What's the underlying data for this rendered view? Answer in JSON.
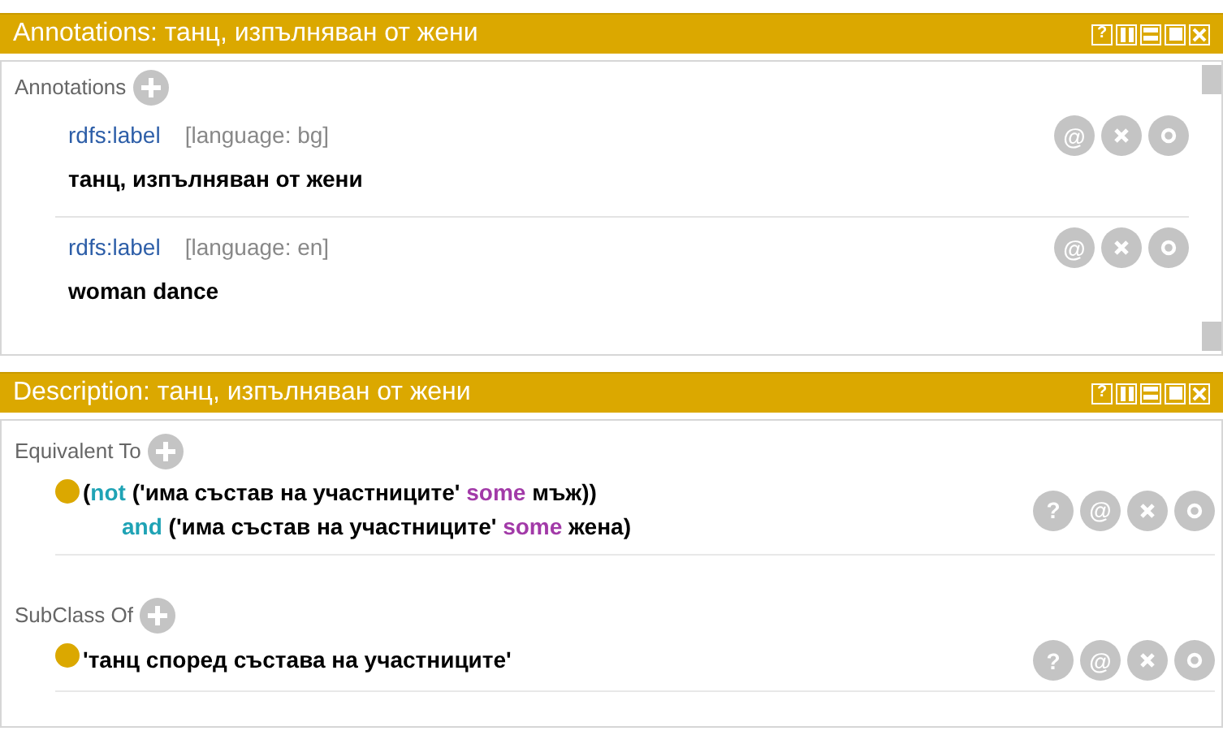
{
  "panels": [
    {
      "kind": "annotations",
      "title": "Annotations: танц, изпълняван от жени",
      "header_buttons": [
        {
          "kind": "help",
          "glyph": "?"
        },
        {
          "kind": "split-v"
        },
        {
          "kind": "split-h"
        },
        {
          "kind": "maximize"
        },
        {
          "kind": "close"
        }
      ],
      "sections": [
        {
          "label": "Annotations",
          "items": [
            {
              "property": "rdfs:label",
              "language": "[language: bg]",
              "value": "танц, изпълняван от жени",
              "actions": [
                {
                  "kind": "annotate",
                  "glyph": "@"
                },
                {
                  "kind": "delete"
                },
                {
                  "kind": "edit"
                }
              ]
            },
            {
              "property": "rdfs:label",
              "language": "[language: en]",
              "value": "woman dance",
              "actions": [
                {
                  "kind": "annotate",
                  "glyph": "@"
                },
                {
                  "kind": "delete"
                },
                {
                  "kind": "edit"
                }
              ]
            }
          ]
        }
      ]
    },
    {
      "kind": "description",
      "title": "Description: танц, изпълняван от жени",
      "header_buttons": [
        {
          "kind": "help",
          "glyph": "?"
        },
        {
          "kind": "split-v"
        },
        {
          "kind": "split-h"
        },
        {
          "kind": "maximize"
        },
        {
          "kind": "close"
        }
      ],
      "sections": [
        {
          "label": "Equivalent To",
          "items": [
            {
              "lines": [
                [
                  {
                    "kind": "plain",
                    "text": "("
                  },
                  {
                    "kind": "keyword",
                    "text": "not"
                  },
                  {
                    "kind": "plain",
                    "text": " ('има състав на участниците' "
                  },
                  {
                    "kind": "quantifier",
                    "text": "some"
                  },
                  {
                    "kind": "plain",
                    "text": " мъж))"
                  }
                ],
                [
                  {
                    "kind": "keyword",
                    "text": "and"
                  },
                  {
                    "kind": "plain",
                    "text": " ('има състав на участниците' "
                  },
                  {
                    "kind": "quantifier",
                    "text": "some"
                  },
                  {
                    "kind": "plain",
                    "text": " жена)"
                  }
                ]
              ],
              "actions": [
                {
                  "kind": "help",
                  "glyph": "?"
                },
                {
                  "kind": "annotate",
                  "glyph": "@"
                },
                {
                  "kind": "delete"
                },
                {
                  "kind": "edit"
                }
              ]
            }
          ]
        },
        {
          "label": "SubClass Of",
          "items": [
            {
              "lines": [
                [
                  {
                    "kind": "plain",
                    "text": "'танц според състава на участниците'"
                  }
                ]
              ],
              "actions": [
                {
                  "kind": "help",
                  "glyph": "?"
                },
                {
                  "kind": "annotate",
                  "glyph": "@"
                },
                {
                  "kind": "delete"
                },
                {
                  "kind": "edit"
                }
              ]
            }
          ]
        }
      ]
    }
  ]
}
